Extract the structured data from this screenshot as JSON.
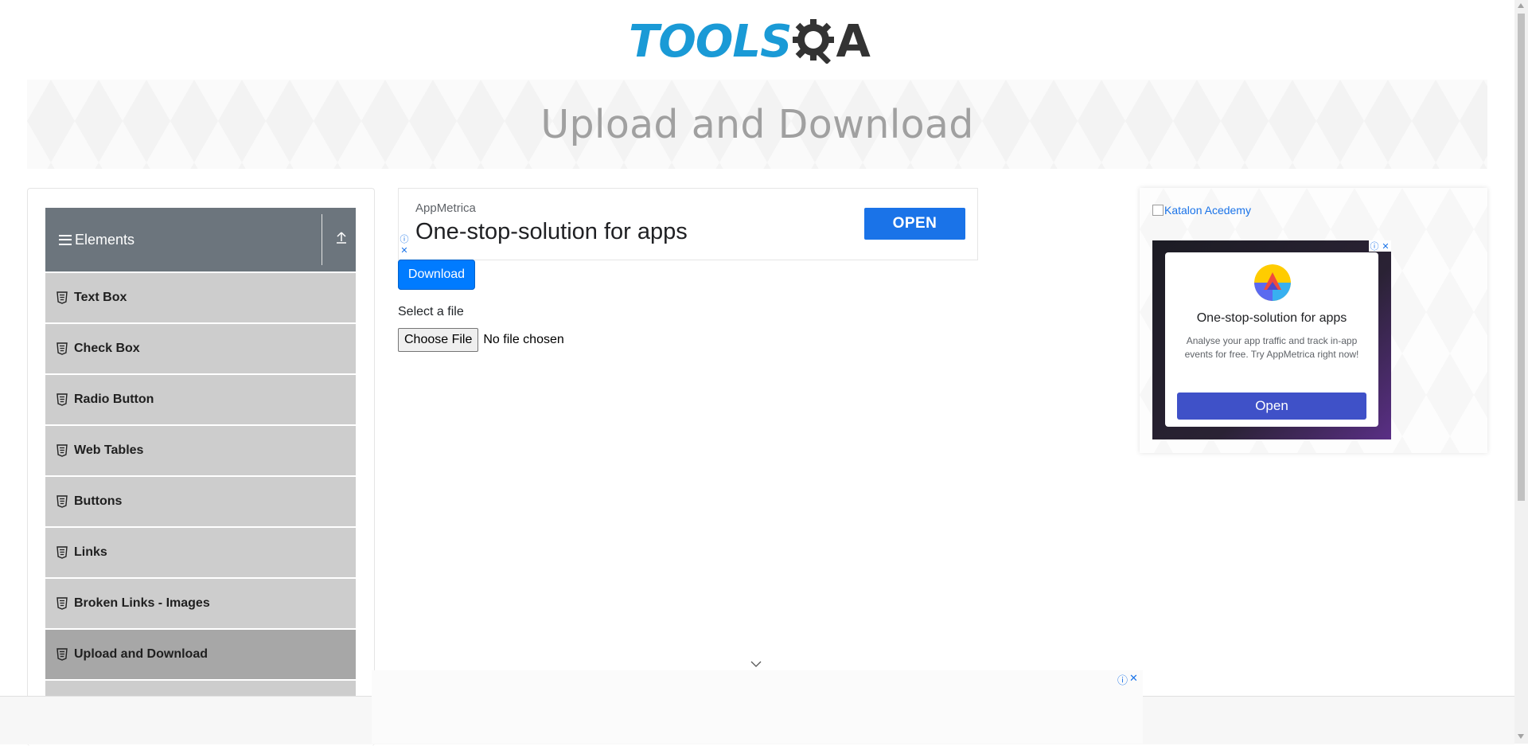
{
  "logo": {
    "part1": "TOOLS",
    "part3": "A",
    "alt": "ToolsQA"
  },
  "banner": {
    "title": "Upload and Download"
  },
  "sidebar": {
    "group_title": "Elements",
    "items": [
      {
        "label": "Text Box",
        "active": false
      },
      {
        "label": "Check Box",
        "active": false
      },
      {
        "label": "Radio Button",
        "active": false
      },
      {
        "label": "Web Tables",
        "active": false
      },
      {
        "label": "Buttons",
        "active": false
      },
      {
        "label": "Links",
        "active": false
      },
      {
        "label": "Broken Links - Images",
        "active": false
      },
      {
        "label": "Upload and Download",
        "active": true
      }
    ]
  },
  "top_ad": {
    "brand": "AppMetrica",
    "headline": "One-stop-solution for apps",
    "cta": "OPEN"
  },
  "main": {
    "download_label": "Download",
    "select_label": "Select a file",
    "choose_file_label": "Choose File",
    "no_file_text": "No file chosen"
  },
  "right_ad": {
    "link_text": "Katalon Acedemy",
    "card_title": "One-stop-solution for apps",
    "card_desc": "Analyse your app traffic and track in-app events for free. Try AppMetrica right now!",
    "card_cta": "Open"
  },
  "icons": {
    "ad_info": "ⓘ",
    "ad_close": "✕"
  },
  "colors": {
    "primary": "#007bff",
    "group_header": "#6c757d",
    "menu_item": "#cdcdcd",
    "menu_item_active": "#a7a7a7",
    "banner_text": "#a0a0a0",
    "ad_button": "#1a73e8",
    "card_button": "#3f51c8"
  }
}
